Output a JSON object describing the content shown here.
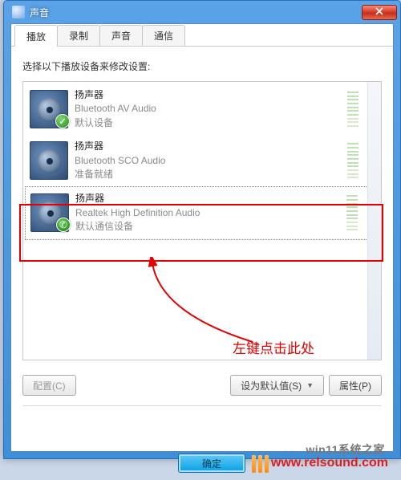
{
  "window": {
    "title": "声音",
    "close_glyph": "x"
  },
  "tabs": {
    "t0": "播放",
    "t1": "录制",
    "t2": "声音",
    "t3": "通信"
  },
  "instruction": "选择以下播放设备来修改设置:",
  "devices": [
    {
      "name": "扬声器",
      "sub": "Bluetooth AV Audio",
      "status": "默认设备",
      "badge": "check"
    },
    {
      "name": "扬声器",
      "sub": "Bluetooth SCO Audio",
      "status": "准备就绪",
      "badge": "none"
    },
    {
      "name": "扬声器",
      "sub": "Realtek High Definition Audio",
      "status": "默认通信设备",
      "badge": "phone"
    }
  ],
  "annotation": {
    "text": "左键点击此处"
  },
  "buttons": {
    "configure": "配置(C)",
    "set_default": "设为默认值(S)",
    "properties": "属性(P)",
    "ok": "确定"
  },
  "watermark_cn": "win11系统之家",
  "watermark_en": "www.relsound.com"
}
